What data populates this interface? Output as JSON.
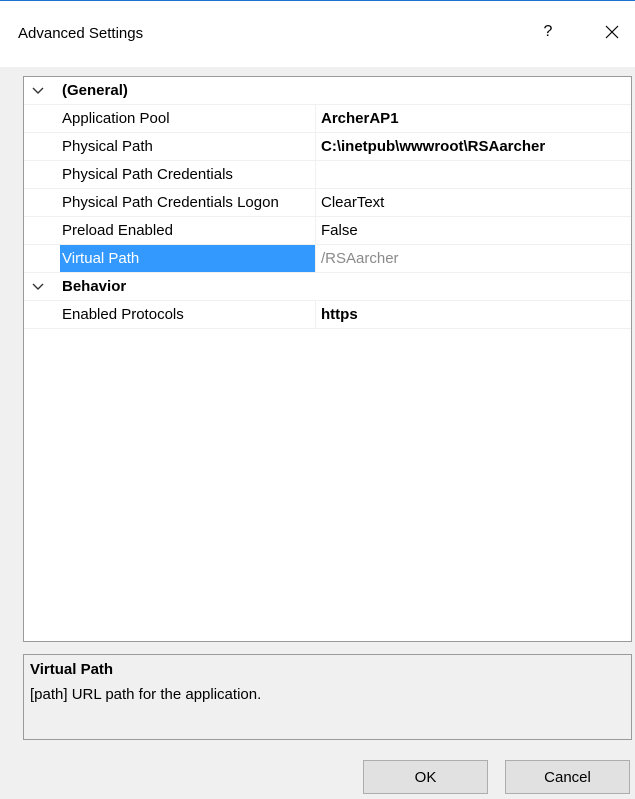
{
  "window": {
    "title": "Advanced Settings",
    "help_label": "?"
  },
  "grid": {
    "categories": [
      {
        "label": "(General)",
        "properties": [
          {
            "name": "Application Pool",
            "value": "ArcherAP1"
          },
          {
            "name": "Physical Path",
            "value": "C:\\inetpub\\wwwroot\\RSAarcher"
          },
          {
            "name": "Physical Path Credentials",
            "value": ""
          },
          {
            "name": "Physical Path Credentials Logon",
            "value": "ClearText"
          },
          {
            "name": "Preload Enabled",
            "value": "False"
          },
          {
            "name": "Virtual Path",
            "value": "/RSAarcher"
          }
        ]
      },
      {
        "label": "Behavior",
        "properties": [
          {
            "name": "Enabled Protocols",
            "value": "https"
          }
        ]
      }
    ]
  },
  "description": {
    "title": "Virtual Path",
    "text": "[path] URL path for the application."
  },
  "buttons": {
    "ok": "OK",
    "cancel": "Cancel"
  },
  "colors": {
    "selection": "#3399ff",
    "title_accent": "#1a74d0",
    "readonly_text": "#8a8a8a"
  }
}
